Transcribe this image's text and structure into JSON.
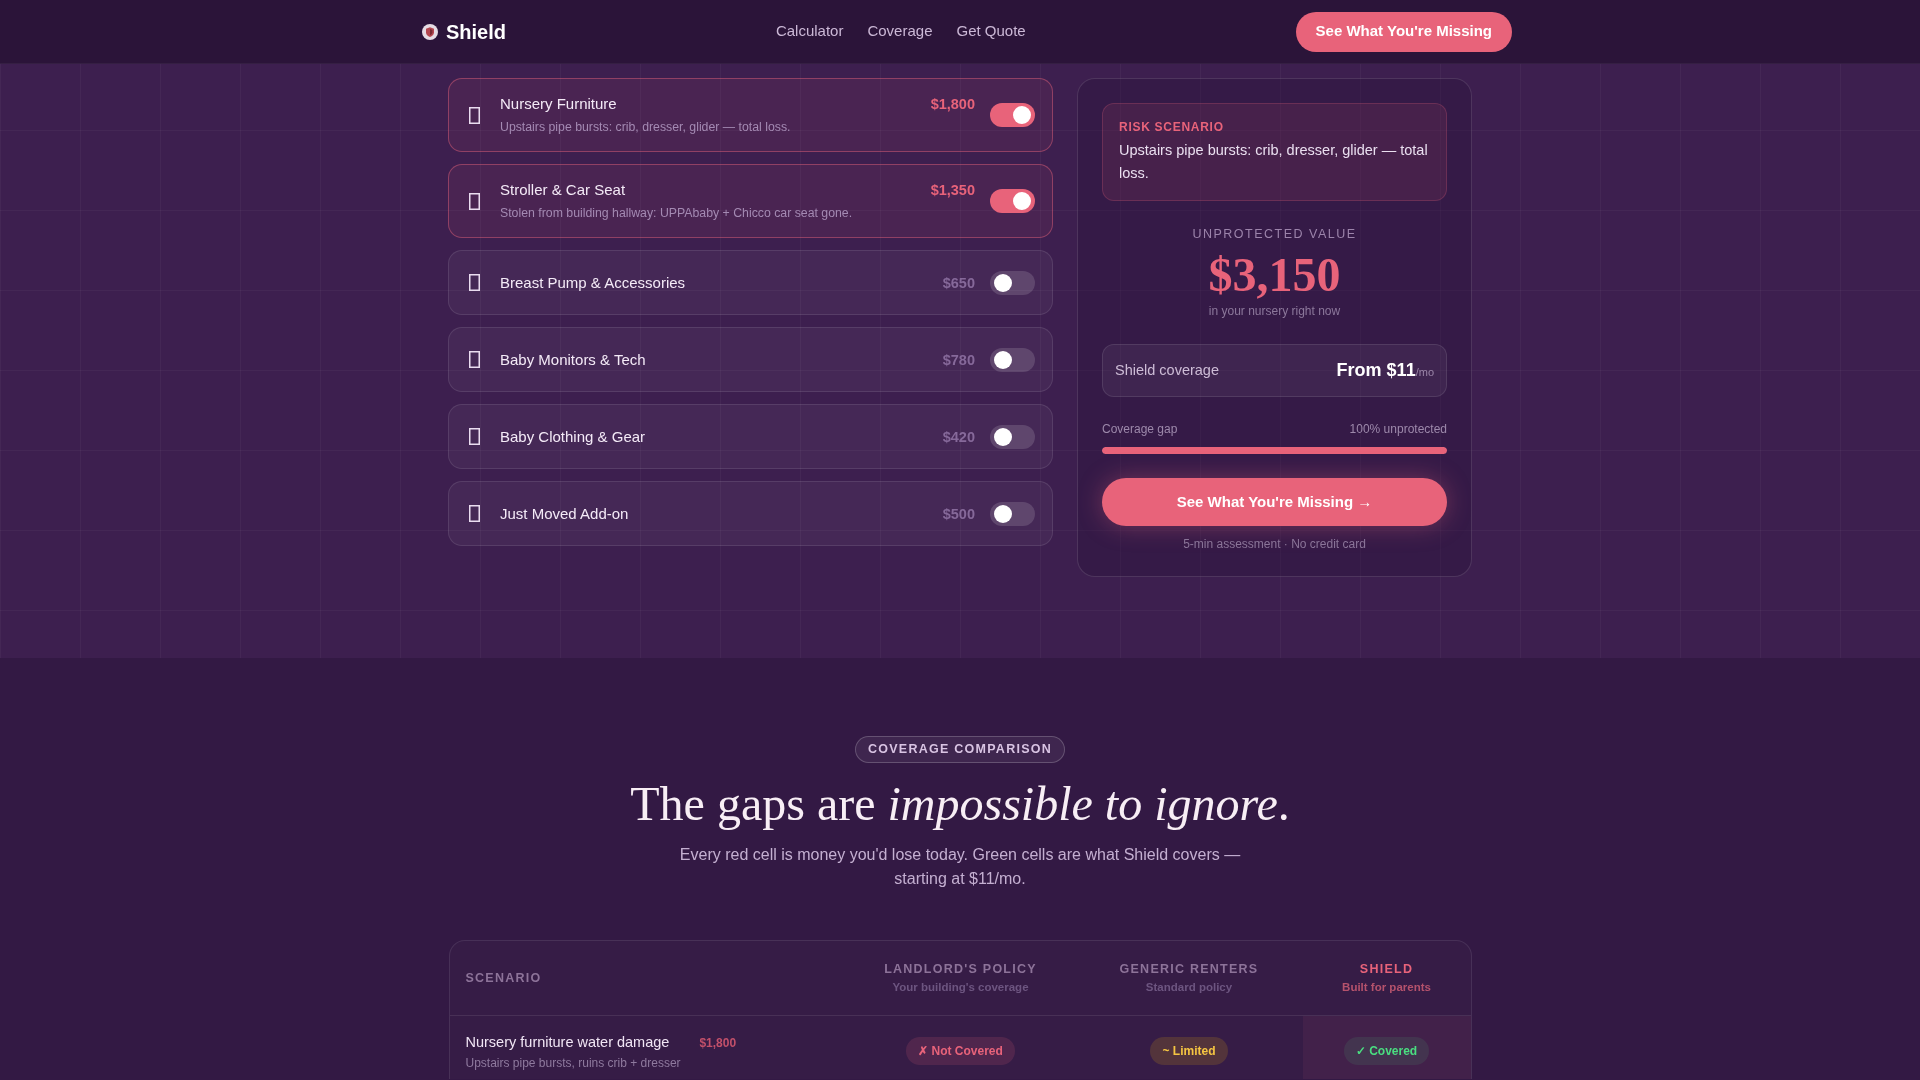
{
  "nav": {
    "brand": "Shield",
    "links": [
      "Calculator",
      "Coverage",
      "Get Quote"
    ],
    "cta": "See What You're Missing"
  },
  "items": [
    {
      "title": "Nursery Furniture",
      "description": "Upstairs pipe bursts: crib, dresser, glider — total loss.",
      "price": "$1,800",
      "on": true
    },
    {
      "title": "Stroller & Car Seat",
      "description": "Stolen from building hallway: UPPAbaby + Chicco car seat gone.",
      "price": "$1,350",
      "on": true
    },
    {
      "title": "Breast Pump & Accessories",
      "price": "$650",
      "on": false
    },
    {
      "title": "Baby Monitors & Tech",
      "price": "$780",
      "on": false
    },
    {
      "title": "Baby Clothing & Gear",
      "price": "$420",
      "on": false
    },
    {
      "title": "Just Moved Add-on",
      "price": "$500",
      "on": false
    }
  ],
  "summary": {
    "risk_label": "RISK SCENARIO",
    "risk_text": "Upstairs pipe bursts: crib, dresser, glider — total loss.",
    "value_label": "UNPROTECTED VALUE",
    "value": "$3,150",
    "value_note": "in your nursery right now",
    "coverage_label": "Shield coverage",
    "coverage_price": "From $11",
    "coverage_unit": "/mo",
    "gap": {
      "label": "Coverage gap",
      "reading": "100% unprotected",
      "level": 1
    },
    "cta": "See What You're Missing →",
    "footnote": "5-min assessment · No credit card"
  },
  "comparison": {
    "badge": "COVERAGE COMPARISON",
    "heading": "The gaps are *impossible to ignore*.",
    "subtitle": "Every red cell is money you'd lose today. Green cells are what Shield covers — starting at $11/mo.",
    "table": {
      "scenario_header": "SCENARIO",
      "columns": [
        {
          "title": "LANDLORD'S POLICY",
          "subtitle": "Your building's coverage",
          "highlight": false
        },
        {
          "title": "GENERIC RENTERS",
          "subtitle": "Standard policy",
          "highlight": false
        },
        {
          "title": "SHIELD",
          "subtitle": "Built for parents",
          "highlight": true
        }
      ],
      "rows": [
        {
          "title": "Nursery furniture water damage",
          "amount": "$1,800",
          "description": "Upstairs pipe bursts, ruins crib + dresser",
          "cells": [
            {
              "kind": "not_covered",
              "text": "✗ Not Covered"
            },
            {
              "kind": "limited",
              "text": "~ Limited"
            },
            {
              "kind": "covered",
              "text": "✓ Covered"
            }
          ]
        }
      ]
    }
  }
}
